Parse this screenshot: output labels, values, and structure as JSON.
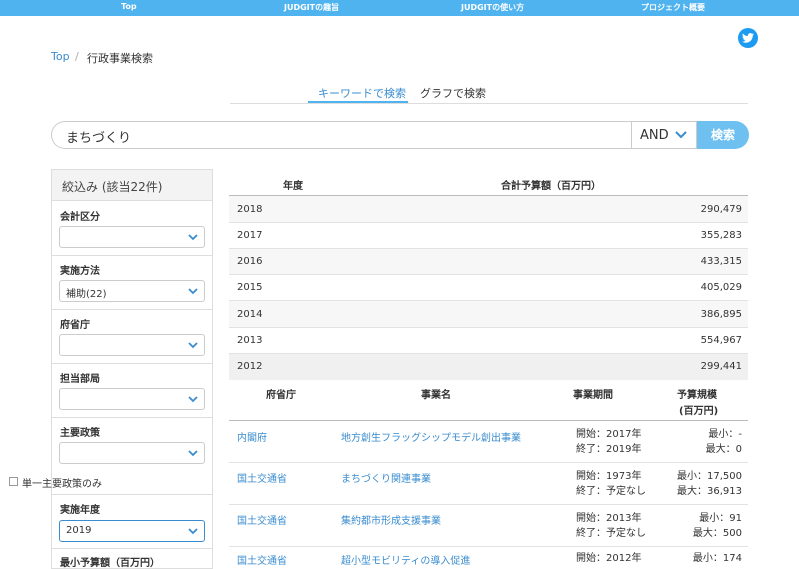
{
  "topnav": {
    "items": [
      "Top",
      "JUDGITの趣旨",
      "JUDGITの使い方",
      "プロジェクト概要"
    ]
  },
  "breadcrumb": {
    "home": "Top",
    "separator": "/",
    "current": "行政事業検索"
  },
  "tabs": {
    "keyword": "キーワードで検索",
    "graph": "グラフで検索"
  },
  "search": {
    "value": "まちづくり",
    "operator": "AND",
    "button": "検索"
  },
  "sidebar": {
    "header": "絞込み (該当22件)",
    "sections": [
      {
        "label": "会計区分",
        "value": ""
      },
      {
        "label": "実施方法",
        "value": "補助(22)"
      },
      {
        "label": "府省庁",
        "value": ""
      },
      {
        "label": "担当部局",
        "value": ""
      },
      {
        "label": "主要政策",
        "value": ""
      },
      {
        "label": "実施年度",
        "value": "2019"
      }
    ],
    "checkbox_label": "単一主要政策のみ",
    "partial_label": "最小予算額（百万円）"
  },
  "budget_table": {
    "headers": [
      "年度",
      "合計予算額（百万円）"
    ],
    "rows": [
      {
        "year": "2018",
        "amount": "290,479"
      },
      {
        "year": "2017",
        "amount": "355,283"
      },
      {
        "year": "2016",
        "amount": "433,315"
      },
      {
        "year": "2015",
        "amount": "405,029"
      },
      {
        "year": "2014",
        "amount": "386,895"
      },
      {
        "year": "2013",
        "amount": "554,967"
      },
      {
        "year": "2012",
        "amount": "299,441"
      }
    ]
  },
  "project_table": {
    "headers": {
      "ministry": "府省庁",
      "name": "事業名",
      "period": "事業期間",
      "budget1": "予算規模",
      "budget2": "(百万円)"
    },
    "rows": [
      {
        "ministry": "内閣府",
        "name": "地方創生フラッグシップモデル創出事業",
        "start": "開始：2017年",
        "end": "終了：2019年",
        "min": "最小：-",
        "max": "最大：0"
      },
      {
        "ministry": "国土交通省",
        "name": "まちづくり関連事業",
        "start": "開始：1973年",
        "end": "終了：予定なし",
        "min": "最小：17,500",
        "max": "最大：36,913"
      },
      {
        "ministry": "国土交通省",
        "name": "集約都市形成支援事業",
        "start": "開始：2013年",
        "end": "終了：予定なし",
        "min": "最小：91",
        "max": "最大：500"
      },
      {
        "ministry": "国土交通省",
        "name": "超小型モビリティの導入促進",
        "start": "開始：2012年",
        "end": "",
        "min": "最小：174",
        "max": ""
      }
    ]
  }
}
